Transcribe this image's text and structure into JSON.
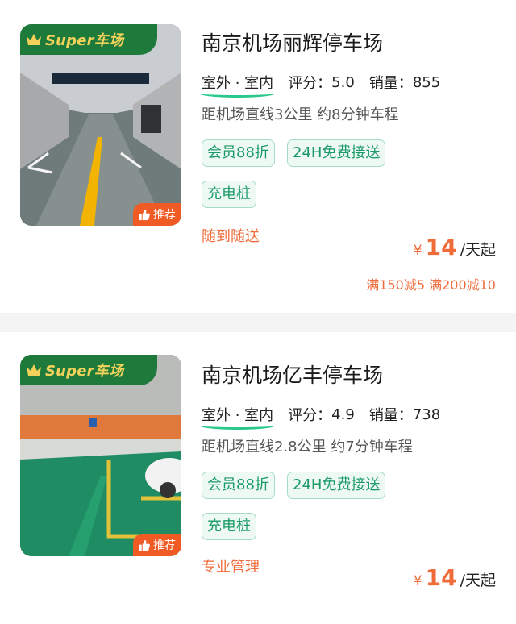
{
  "badge": {
    "super_label": "Super车场",
    "recommend_label": "推荐"
  },
  "colors": {
    "accent_orange": "#f06b3a",
    "tag_green": "#1a9a66",
    "banner_green": "#1d7a3a",
    "crown_gold": "#f2d25a"
  },
  "listings": [
    {
      "name": "南京机场丽辉停车场",
      "location": "室外 · 室内",
      "rating_label": "评分：",
      "rating": "5.0",
      "sales_label": "销量：",
      "sales": "855",
      "distance": "距机场直线3公里 约8分钟车程",
      "tags": [
        "会员88折",
        "24H免费接送",
        "充电桩"
      ],
      "service": "随到随送",
      "price": {
        "currency": "¥",
        "amount": "14",
        "unit": "/天起"
      },
      "promo": "满150减5 满200减10"
    },
    {
      "name": "南京机场亿丰停车场",
      "location": "室外 · 室内",
      "rating_label": "评分：",
      "rating": "4.9",
      "sales_label": "销量：",
      "sales": "738",
      "distance": "距机场直线2.8公里 约7分钟车程",
      "tags": [
        "会员88折",
        "24H免费接送",
        "充电桩"
      ],
      "service": "专业管理",
      "price": {
        "currency": "¥",
        "amount": "14",
        "unit": "/天起"
      }
    }
  ]
}
